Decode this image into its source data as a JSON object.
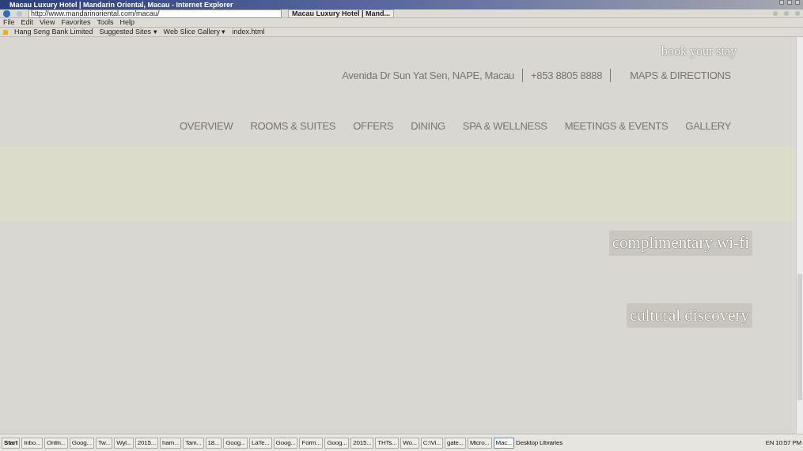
{
  "window": {
    "title": "Macau Luxury Hotel | Mandarin Oriental, Macau - Internet Explorer"
  },
  "address_bar": {
    "url": "http://www.mandarinoriental.com/macau/"
  },
  "browser_tabs": [
    {
      "label": "Macau Luxury Hotel | Mand...",
      "selected": true
    }
  ],
  "menu": [
    "File",
    "Edit",
    "View",
    "Favorites",
    "Tools",
    "Help"
  ],
  "favorites": [
    "Hang Seng Bank Limited",
    "Suggested Sites ▾",
    "Web Slice Gallery ▾",
    "index.html"
  ],
  "page": {
    "book_link": "book your stay",
    "contact": [
      {
        "kind": "text",
        "text": "Avenida Dr Sun Yat Sen, NAPE, Macau"
      },
      {
        "kind": "text",
        "text": "+853 8805 8888"
      },
      {
        "kind": "link",
        "text": "MAPS & DIRECTIONS"
      }
    ],
    "nav": [
      "OVERVIEW",
      "ROOMS & SUITES",
      "OFFERS",
      "DINING",
      "SPA & WELLNESS",
      "MEETINGS & EVENTS",
      "GALLERY"
    ],
    "features": [
      "complimentary wi-fi",
      "cultural discovery"
    ]
  },
  "taskbar": {
    "start": "Start",
    "items": [
      {
        "label": "Inbo...",
        "selected": false
      },
      {
        "label": "Onlin...",
        "selected": false
      },
      {
        "label": "Goog...",
        "selected": false
      },
      {
        "label": "Tw...",
        "selected": false
      },
      {
        "label": "Wyl...",
        "selected": false
      },
      {
        "label": "2015...",
        "selected": false
      },
      {
        "label": "ham...",
        "selected": false
      },
      {
        "label": "Tam...",
        "selected": false
      },
      {
        "label": "18...",
        "selected": false
      },
      {
        "label": "Goog...",
        "selected": false
      },
      {
        "label": "LaTe...",
        "selected": false
      },
      {
        "label": "Goog...",
        "selected": false
      },
      {
        "label": "Form...",
        "selected": false
      },
      {
        "label": "Goog...",
        "selected": false
      },
      {
        "label": "2015...",
        "selected": false
      },
      {
        "label": "THTs...",
        "selected": false
      },
      {
        "label": "Wo...",
        "selected": false
      },
      {
        "label": "C:\\Vi...",
        "selected": false
      },
      {
        "label": "gate...",
        "selected": false
      },
      {
        "label": "Micro...",
        "selected": false
      },
      {
        "label": "Mac...",
        "selected": true
      }
    ],
    "toolbars": [
      "Desktop",
      "Libraries"
    ],
    "language": "EN",
    "clock": "10:57 PM"
  }
}
